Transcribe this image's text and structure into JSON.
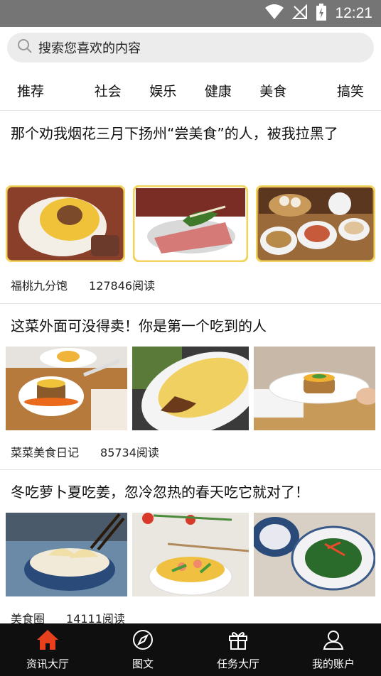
{
  "status": {
    "time": "12:21"
  },
  "search": {
    "placeholder": "搜索您喜欢的内容"
  },
  "tabs": [
    {
      "label": "推荐"
    },
    {
      "label": "社会"
    },
    {
      "label": "娱乐"
    },
    {
      "label": "健康"
    },
    {
      "label": "美食"
    },
    {
      "label": "搞笑"
    }
  ],
  "articles": [
    {
      "title": "那个劝我烟花三月下扬州“尝美食”的人，被我拉黑了",
      "source": "福桃九分饱",
      "reads": "127846阅读"
    },
    {
      "title": "这菜外面可没得卖！你是第一个吃到的人",
      "source": "菜菜美食日记",
      "reads": "85734阅读"
    },
    {
      "title": "冬吃萝卜夏吃姜，忽冷忽热的春天吃它就对了！",
      "source": "美食圈",
      "reads": "14111阅读"
    }
  ],
  "nav": [
    {
      "label": "资讯大厅",
      "icon": "home-icon"
    },
    {
      "label": "图文",
      "icon": "compass-icon"
    },
    {
      "label": "任务大厅",
      "icon": "gift-icon"
    },
    {
      "label": "我的账户",
      "icon": "user-icon"
    }
  ],
  "colors": {
    "accent": "#e8401c",
    "statusbar": "#757575",
    "navbar": "#0f0f0f"
  }
}
